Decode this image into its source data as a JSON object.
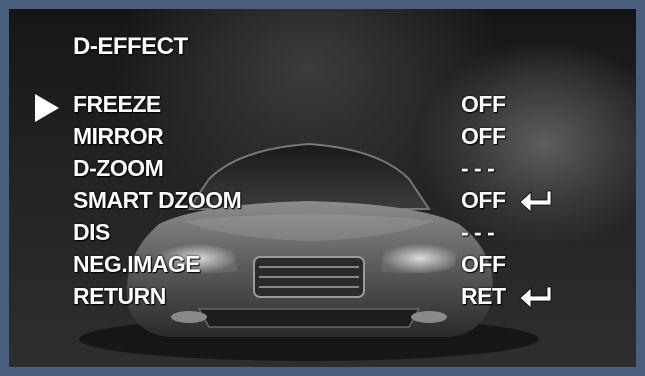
{
  "menu": {
    "title": "D-EFFECT",
    "items": [
      {
        "label": "FREEZE",
        "value": "OFF",
        "enter": false,
        "selected": true
      },
      {
        "label": "MIRROR",
        "value": "OFF",
        "enter": false,
        "selected": false
      },
      {
        "label": "D-ZOOM",
        "value": "- - -",
        "enter": false,
        "selected": false
      },
      {
        "label": "SMART DZOOM",
        "value": "OFF",
        "enter": true,
        "selected": false
      },
      {
        "label": "DIS",
        "value": "- - -",
        "enter": false,
        "selected": false
      },
      {
        "label": "NEG.IMAGE",
        "value": "OFF",
        "enter": false,
        "selected": false
      },
      {
        "label": "RETURN",
        "value": "RET",
        "enter": true,
        "selected": false
      }
    ]
  },
  "icons": {
    "cursor": "triangle-right-icon",
    "enter": "enter-arrow-icon"
  },
  "colors": {
    "frame": "#4a5e80",
    "text": "#ffffff"
  }
}
